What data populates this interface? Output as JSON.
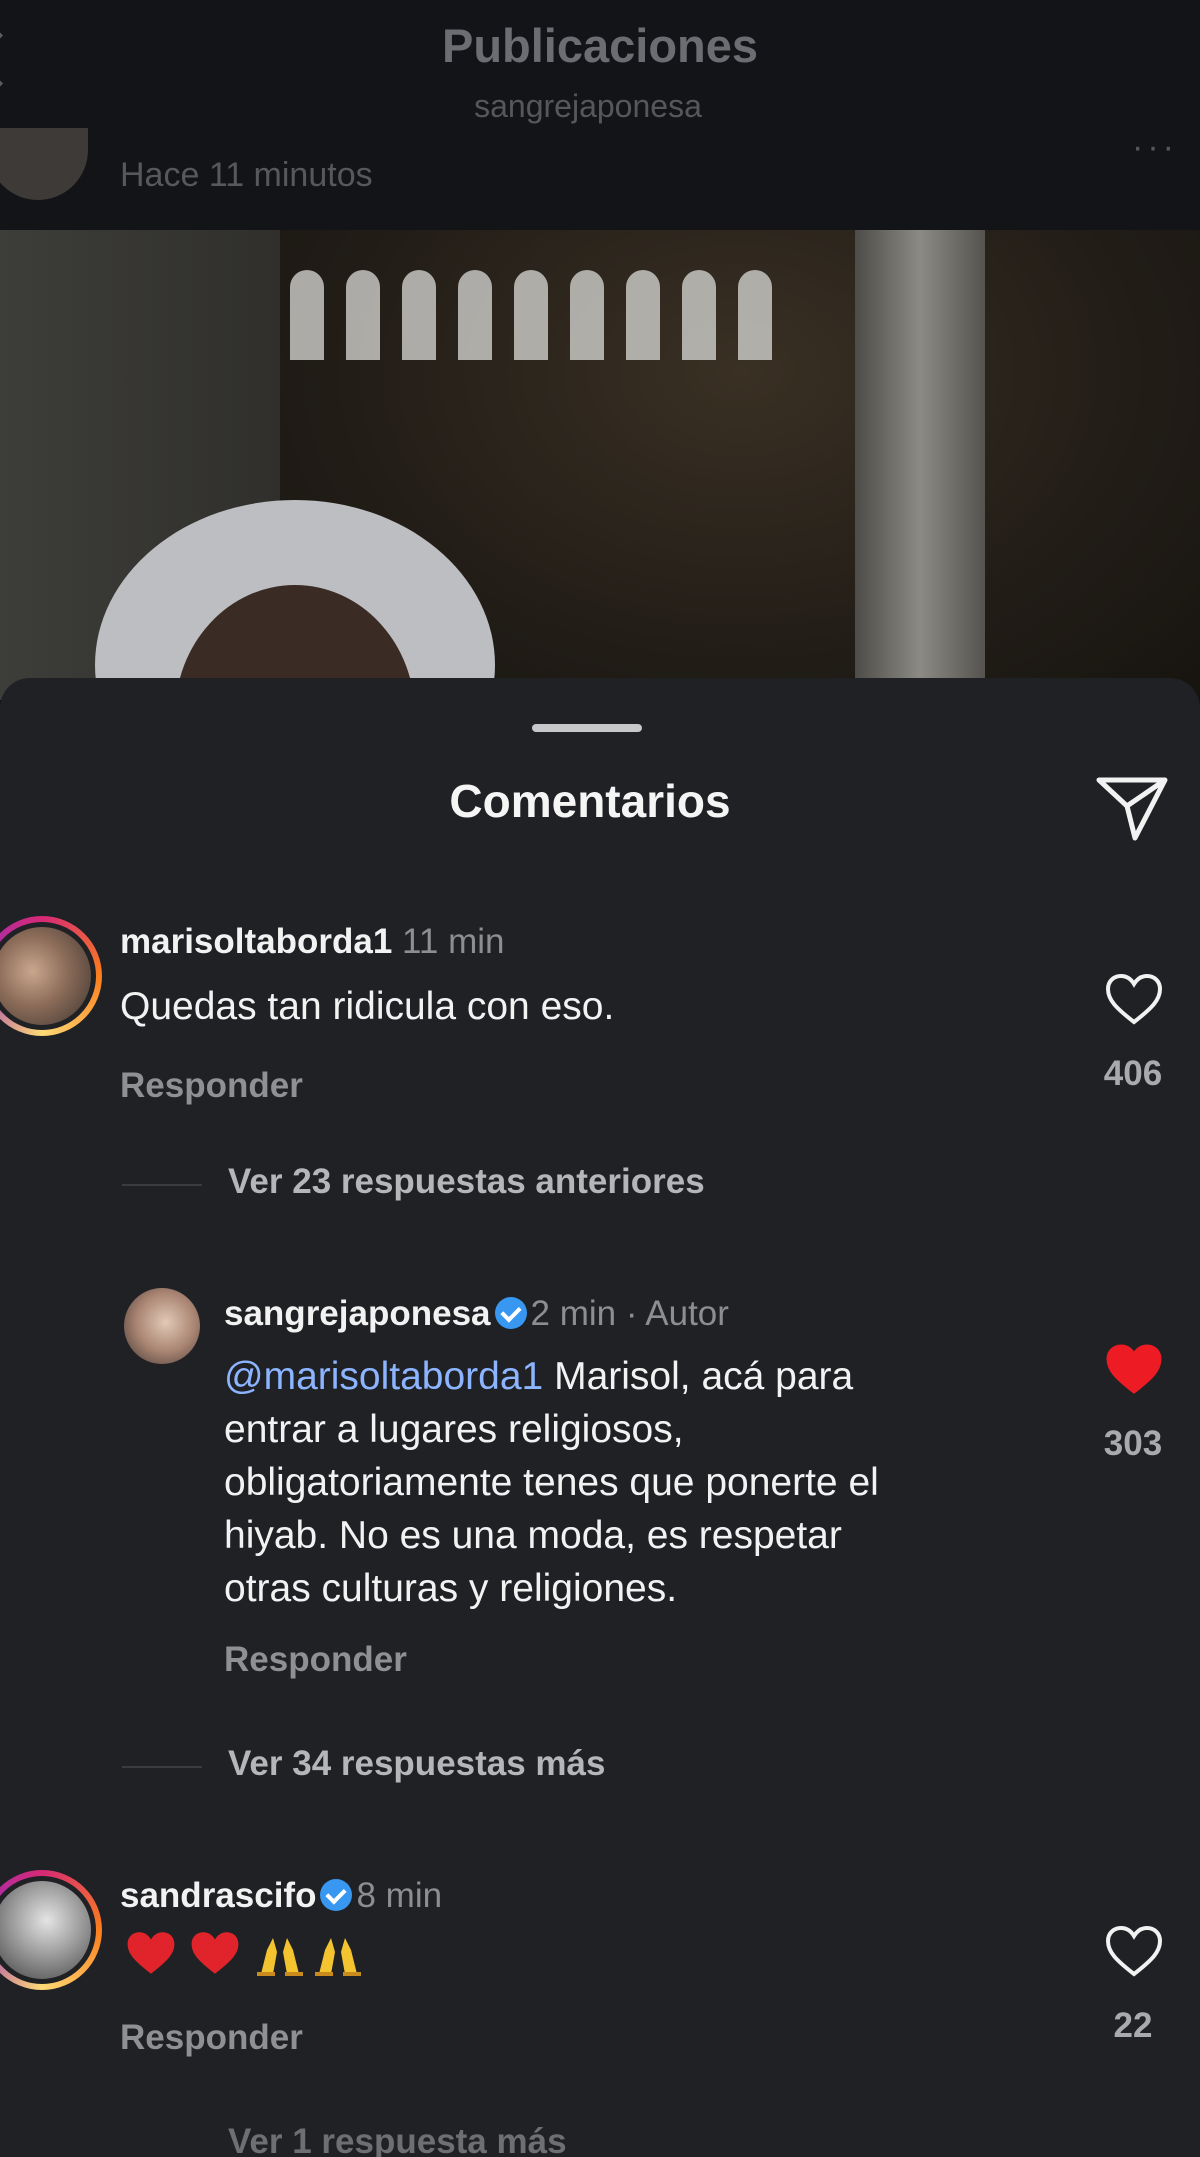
{
  "header": {
    "title": "Publicaciones",
    "subtitle": "sangrejaponesa",
    "post_time": "Hace 11 minutos",
    "more": "···"
  },
  "sheet": {
    "title": "Comentarios"
  },
  "comments": [
    {
      "username": "marisoltaborda1",
      "time": "11 min",
      "text": "Quedas tan ridicula con eso.",
      "reply_label": "Responder",
      "likes": "406",
      "liked": false,
      "view_replies": "Ver 23 respuestas anteriores"
    },
    {
      "username": "sangrejaponesa",
      "verified": true,
      "time": "2 min",
      "author_tag": "· Autor",
      "mention": "@marisoltaborda1",
      "text_lines": [
        " Marisol, acá para",
        "entrar a lugares religiosos,",
        "obligatoriamente tenes que ponerte el",
        "hiyab. No es una moda, es respetar",
        "otras culturas y religiones."
      ],
      "reply_label": "Responder",
      "likes": "303",
      "liked": true,
      "like_color": "#ed1c24",
      "view_replies": "Ver 34 respuestas más"
    },
    {
      "username": "sandrascifo",
      "verified": true,
      "time": "8 min",
      "emojis": [
        "red-heart",
        "red-heart",
        "praying-hands",
        "praying-hands"
      ],
      "reply_label": "Responder",
      "likes": "22",
      "liked": false,
      "view_replies": "Ver 1 respuesta más"
    }
  ],
  "colors": {
    "background": "#1f2125",
    "accent_mention": "#8cb4ff",
    "verified": "#3897f0",
    "liked_heart": "#ed1c24"
  }
}
